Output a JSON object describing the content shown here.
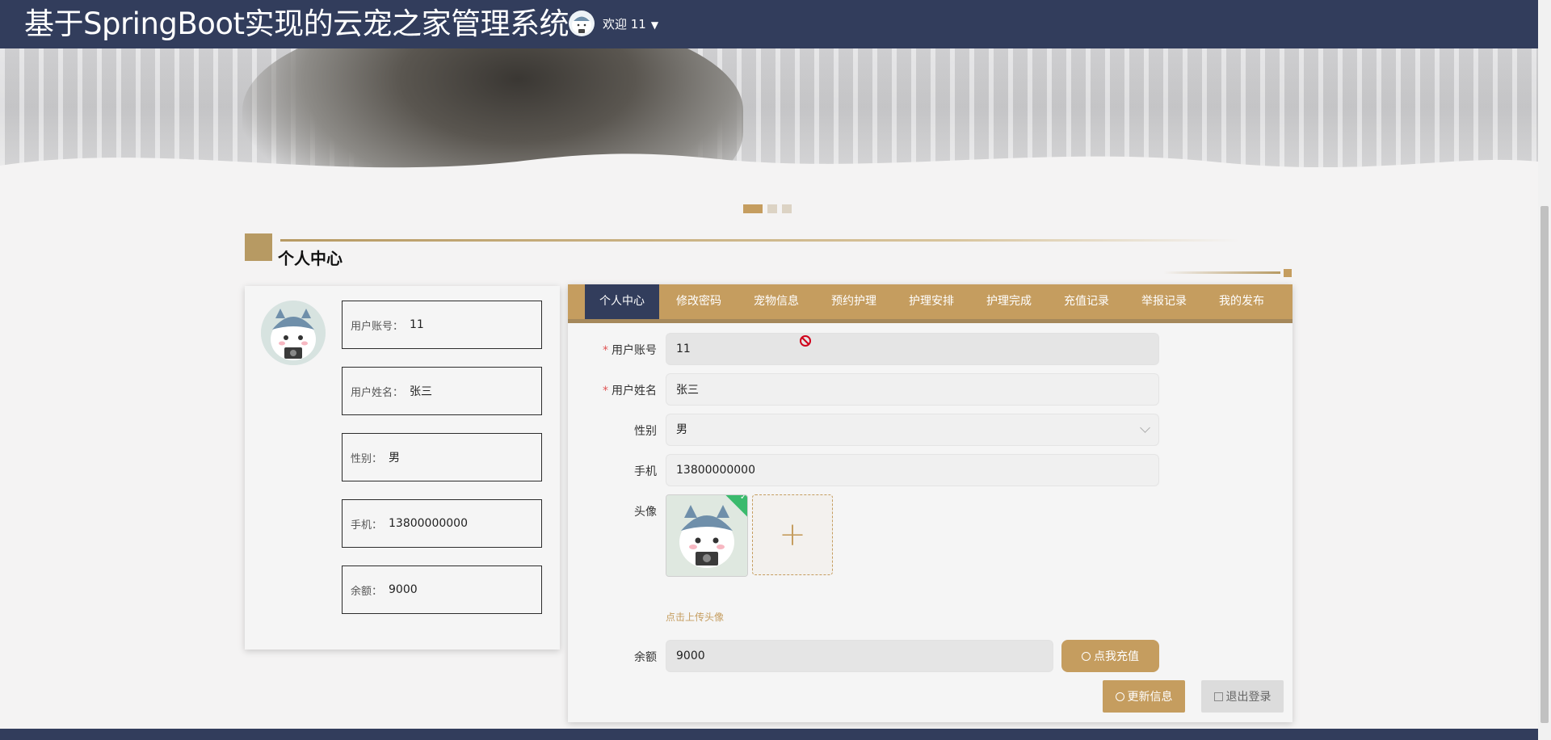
{
  "header": {
    "title": "基于SpringBoot实现的云宠之家管理系统",
    "welcome": "欢迎 11",
    "dropdown_icon": "caret-down-icon"
  },
  "section": {
    "title": "个人中心"
  },
  "carousel": {
    "slides": 3,
    "active": 1
  },
  "profile": {
    "fields": [
      {
        "key": "用户账号：",
        "value": "11"
      },
      {
        "key": "用户姓名：",
        "value": "张三"
      },
      {
        "key": "性别：",
        "value": "男"
      },
      {
        "key": "手机：",
        "value": "13800000000"
      },
      {
        "key": "余额：",
        "value": "9000"
      }
    ]
  },
  "tabs": [
    {
      "label": "个人中心",
      "active": true
    },
    {
      "label": "修改密码"
    },
    {
      "label": "宠物信息"
    },
    {
      "label": "预约护理"
    },
    {
      "label": "护理安排"
    },
    {
      "label": "护理完成"
    },
    {
      "label": "充值记录"
    },
    {
      "label": "举报记录"
    },
    {
      "label": "我的发布"
    }
  ],
  "form": {
    "account": {
      "label": "用户账号",
      "value": "11",
      "required": true
    },
    "name": {
      "label": "用户姓名",
      "value": "张三",
      "required": true
    },
    "gender": {
      "label": "性别",
      "value": "男"
    },
    "phone": {
      "label": "手机",
      "value": "13800000000"
    },
    "avatar": {
      "label": "头像",
      "hint": "点击上传头像"
    },
    "balance": {
      "label": "余额",
      "value": "9000"
    },
    "recharge_button": "点我充值",
    "update_button": "更新信息",
    "logout_button": "退出登录"
  },
  "colors": {
    "accent": "#c59d5f",
    "navy": "#323d5c",
    "required": "#e05555",
    "success": "#3aba6d"
  }
}
